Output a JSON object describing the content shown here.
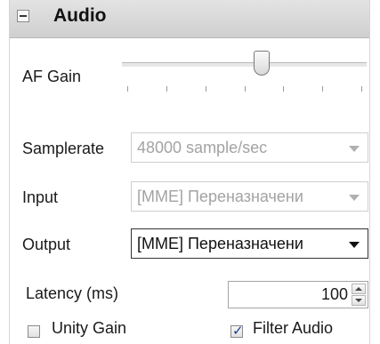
{
  "panel": {
    "title": "Audio",
    "collapse_icon": "minus-square-icon"
  },
  "af_gain": {
    "label": "AF Gain",
    "slider_level": 0.57,
    "tick_count": 7
  },
  "samplerate": {
    "label": "Samplerate",
    "value": "48000 sample/sec",
    "enabled": false
  },
  "input": {
    "label": "Input",
    "value": "[MME] Переназначени",
    "enabled": false
  },
  "output": {
    "label": "Output",
    "value": "[MME] Переназначени",
    "enabled": true
  },
  "latency": {
    "label": "Latency (ms)",
    "value": "100"
  },
  "unity_gain": {
    "label": "Unity Gain",
    "checked": false
  },
  "filter_audio": {
    "label": "Filter Audio",
    "checked": true,
    "check_glyph": "✓"
  }
}
